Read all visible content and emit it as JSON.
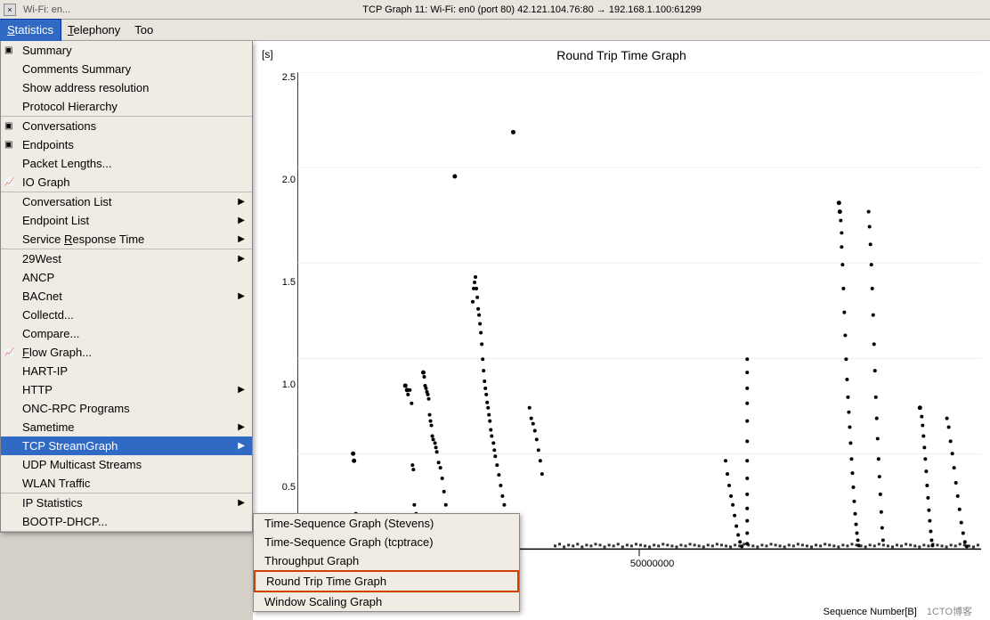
{
  "titleBar": {
    "prevTabLabel": "Wi-Fi: en...",
    "closeIcon": "×",
    "title": "TCP Graph 11: Wi-Fi: en0 (port 80) 42.121.104.76:80 → 192.168.1.100:61299"
  },
  "menuBar": {
    "items": [
      {
        "id": "statistics",
        "label": "Statistics",
        "underlineIndex": 0,
        "active": true
      },
      {
        "id": "telephony",
        "label": "Telephony",
        "underlineIndex": 0,
        "active": false
      },
      {
        "id": "tools",
        "label": "Too",
        "underlineIndex": 0,
        "active": false
      }
    ]
  },
  "statisticsMenu": {
    "sections": [
      {
        "items": [
          {
            "id": "summary",
            "label": "Summary",
            "icon": "▣",
            "hasArrow": false
          },
          {
            "id": "comments-summary",
            "label": "Comments Summary",
            "icon": "",
            "hasArrow": false
          },
          {
            "id": "show-address",
            "label": "Show address resolution",
            "icon": "",
            "hasArrow": false
          },
          {
            "id": "protocol-hierarchy",
            "label": "Protocol Hierarchy",
            "icon": "",
            "hasArrow": false
          }
        ]
      },
      {
        "items": [
          {
            "id": "conversations",
            "label": "Conversations",
            "icon": "▣",
            "hasArrow": false
          },
          {
            "id": "endpoints",
            "label": "Endpoints",
            "icon": "▣",
            "hasArrow": false
          },
          {
            "id": "packet-lengths",
            "label": "Packet Lengths...",
            "icon": "",
            "hasArrow": false
          },
          {
            "id": "io-graph",
            "label": "IO Graph",
            "icon": "📈",
            "hasArrow": false
          }
        ]
      },
      {
        "items": [
          {
            "id": "conversation-list",
            "label": "Conversation List",
            "icon": "",
            "hasArrow": true
          },
          {
            "id": "endpoint-list",
            "label": "Endpoint List",
            "icon": "",
            "hasArrow": true
          },
          {
            "id": "service-response-time",
            "label": "Service Response Time",
            "icon": "",
            "hasArrow": true
          }
        ]
      },
      {
        "items": [
          {
            "id": "29west",
            "label": "29West",
            "icon": "",
            "hasArrow": true
          },
          {
            "id": "ancp",
            "label": "ANCP",
            "icon": "",
            "hasArrow": false
          },
          {
            "id": "bacnet",
            "label": "BACnet",
            "icon": "",
            "hasArrow": true
          },
          {
            "id": "collectd",
            "label": "Collectd...",
            "icon": "",
            "hasArrow": false
          },
          {
            "id": "compare",
            "label": "Compare...",
            "icon": "",
            "hasArrow": false
          },
          {
            "id": "flow-graph",
            "label": "Flow Graph...",
            "icon": "📈",
            "hasArrow": false
          },
          {
            "id": "hart-ip",
            "label": "HART-IP",
            "icon": "",
            "hasArrow": false
          },
          {
            "id": "http",
            "label": "HTTP",
            "icon": "",
            "hasArrow": true
          },
          {
            "id": "onc-rpc",
            "label": "ONC-RPC Programs",
            "icon": "",
            "hasArrow": false
          },
          {
            "id": "sametime",
            "label": "Sametime",
            "icon": "",
            "hasArrow": true
          },
          {
            "id": "tcp-streamgraph",
            "label": "TCP StreamGraph",
            "icon": "",
            "hasArrow": true,
            "highlighted": true
          },
          {
            "id": "udp-multicast",
            "label": "UDP Multicast Streams",
            "icon": "",
            "hasArrow": false
          },
          {
            "id": "wlan-traffic",
            "label": "WLAN Traffic",
            "icon": "",
            "hasArrow": false
          }
        ]
      },
      {
        "items": [
          {
            "id": "ip-statistics",
            "label": "IP Statistics",
            "icon": "",
            "hasArrow": true
          },
          {
            "id": "bootp-dhcp",
            "label": "BOOTP-DHCP...",
            "icon": "",
            "hasArrow": false
          }
        ]
      }
    ]
  },
  "tcpSubmenu": {
    "top": 530,
    "items": [
      {
        "id": "time-seq-stevens",
        "label": "Time-Sequence Graph (Stevens)",
        "selected": false
      },
      {
        "id": "time-seq-tcptrace",
        "label": "Time-Sequence Graph (tcptrace)",
        "selected": false
      },
      {
        "id": "throughput-graph",
        "label": "Throughput Graph",
        "selected": false
      },
      {
        "id": "round-trip-time",
        "label": "Round Trip Time Graph",
        "selected": true
      },
      {
        "id": "window-scaling",
        "label": "Window Scaling Graph",
        "selected": false
      }
    ]
  },
  "graph": {
    "title": "Round Trip Time Graph",
    "yAxisUnit": "[s]",
    "xAxisLabel": "Sequence Number[B]",
    "xAxisTick": "50000000",
    "watermark": "1CTO博客",
    "yTicks": [
      "2.5",
      "2.0",
      "1.5",
      "1.0",
      "0.5",
      ""
    ],
    "dataPoints": []
  }
}
